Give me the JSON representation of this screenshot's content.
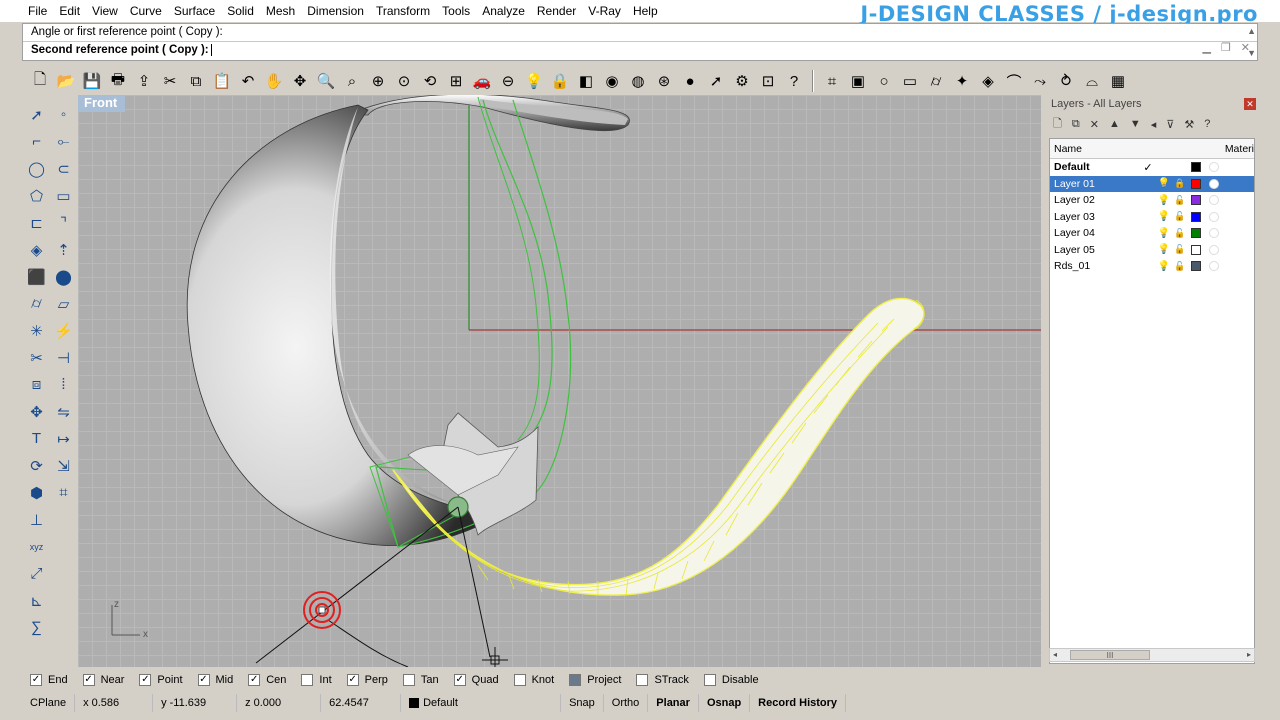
{
  "menu": [
    "File",
    "Edit",
    "View",
    "Curve",
    "Surface",
    "Solid",
    "Mesh",
    "Dimension",
    "Transform",
    "Tools",
    "Analyze",
    "Render",
    "V-Ray",
    "Help"
  ],
  "brand": "J-DESIGN CLASSES /  j-design.pro",
  "command": {
    "history": "Angle or first reference point ( Copy ):",
    "prompt": "Second reference point ( Copy ):"
  },
  "toolbar_icons": [
    "new-file-icon",
    "open-folder-icon",
    "save-icon",
    "print-icon",
    "import-icon",
    "cut-icon",
    "copy-icon",
    "paste-icon",
    "undo-icon",
    "pan-hand-icon",
    "rotate-view-icon",
    "zoom-icon",
    "zoom-window-icon",
    "zoom-extents-icon",
    "zoom-selected-icon",
    "rotate-icon",
    "grid-viewports-icon",
    "car-icon",
    "cplane-icon",
    "light-icon",
    "lock-icon",
    "layer-icon",
    "color-wheel-icon",
    "sphere-shade-icon",
    "wire-sphere-icon",
    "render-sphere-icon",
    "select-icon",
    "gear-icon",
    "options-icon",
    "help-icon",
    "snap-grid-icon",
    "box-icon",
    "circle-icon",
    "frame-icon",
    "cylinder-icon",
    "curve-network-icon",
    "patch-icon",
    "loft-icon",
    "sweep-icon",
    "revolve-icon",
    "arch-icon",
    "window-icon"
  ],
  "left_tools": [
    "select-arrow-icon",
    "point-icon",
    "polyline-icon",
    "curve-rect-icon",
    "circle-tool-icon",
    "ellipse-icon",
    "polygon-icon",
    "rectangle-icon",
    "offset-icon",
    "fillet-icon",
    "surface-patch-icon",
    "extrude-icon",
    "solid-box-icon",
    "boolean-icon",
    "cylinder-tool-icon",
    "plane-icon",
    "explode-icon",
    "split-icon",
    "trim-icon",
    "join-icon",
    "group-icon",
    "array-icon",
    "move-icon",
    "mirror-icon",
    "text-icon",
    "dimension-icon",
    "transform-icon",
    "scale-icon",
    "render-mesh-icon",
    "analyze-icon"
  ],
  "left_tools_lower": [
    "dimension-line-icon",
    "xyz-icon",
    "curve-analysis-icon",
    "angle-icon",
    "sigma-icon"
  ],
  "viewport": {
    "label": "Front",
    "axis_x": "x",
    "axis_z": "z"
  },
  "layers": {
    "title": "Layers - All Layers",
    "col_name": "Name",
    "col_material": "Materi",
    "rows": [
      {
        "name": "Default",
        "current": "✓",
        "color": "#000000",
        "bold": true,
        "selected": false,
        "locked": false
      },
      {
        "name": "Layer 01",
        "current": "",
        "color": "#ff0000",
        "bold": false,
        "selected": true,
        "locked": true
      },
      {
        "name": "Layer 02",
        "current": "",
        "color": "#8a2be2",
        "bold": false,
        "selected": false,
        "locked": false
      },
      {
        "name": "Layer 03",
        "current": "",
        "color": "#0000ff",
        "bold": false,
        "selected": false,
        "locked": false
      },
      {
        "name": "Layer 04",
        "current": "",
        "color": "#008000",
        "bold": false,
        "selected": false,
        "locked": false
      },
      {
        "name": "Layer 05",
        "current": "",
        "color": "#ffffff",
        "bold": false,
        "selected": false,
        "locked": false
      },
      {
        "name": "Rds_01",
        "current": "",
        "color": "#4a5a6a",
        "bold": false,
        "selected": false,
        "locked": false
      }
    ],
    "scroll_thumb": "III"
  },
  "osnaps": [
    {
      "label": "End",
      "checked": true
    },
    {
      "label": "Near",
      "checked": true
    },
    {
      "label": "Point",
      "checked": true
    },
    {
      "label": "Mid",
      "checked": true
    },
    {
      "label": "Cen",
      "checked": true
    },
    {
      "label": "Int",
      "checked": false
    },
    {
      "label": "Perp",
      "checked": true
    },
    {
      "label": "Tan",
      "checked": false
    },
    {
      "label": "Quad",
      "checked": true
    },
    {
      "label": "Knot",
      "checked": false
    },
    {
      "label": "Project",
      "checked": true
    },
    {
      "label": "STrack",
      "checked": false
    },
    {
      "label": "Disable",
      "checked": false
    }
  ],
  "status": {
    "cplane": "CPlane",
    "x": "x 0.586",
    "y": "y -11.639",
    "z": "z 0.000",
    "distance": "62.4547",
    "layer": "Default",
    "snap": "Snap",
    "ortho": "Ortho",
    "planar": "Planar",
    "osnap": "Osnap",
    "record_history": "Record History"
  }
}
